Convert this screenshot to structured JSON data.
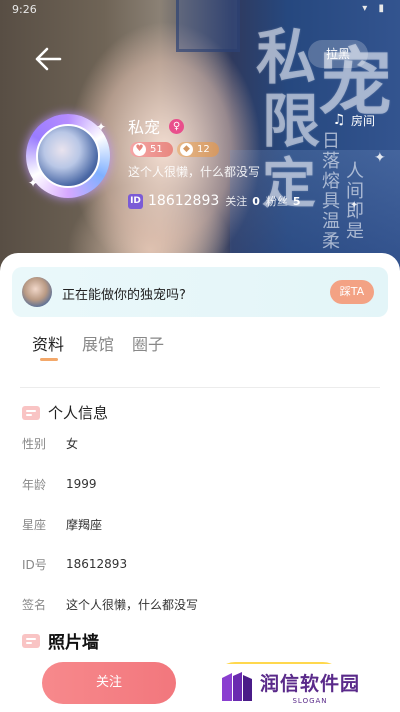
{
  "status_bar": {
    "time": "9:26",
    "icons": "▾ ▮"
  },
  "header": {
    "back_icon": "arrow-left-icon",
    "block_label": "拉黑",
    "room_label": "房间",
    "room_icon": "music-note-icon",
    "background_text": [
      "私",
      "限",
      "定",
      "宠"
    ],
    "background_small_text": [
      "日落熔具温柔",
      "人间即是"
    ]
  },
  "profile": {
    "nickname": "私宠",
    "gender": "female",
    "gender_icon": "♀",
    "wealth_level": "51",
    "charm_level": "12",
    "signature": "这个人很懒，什么都没写",
    "id_badge": "ID",
    "id": "18612893",
    "follow_label": "关注",
    "follow_count": "0",
    "fans_label": "粉丝",
    "fans_count": "5"
  },
  "exclusive_banner": {
    "text": "正在能做你的独宠吗?",
    "button_label": "踩TA"
  },
  "tabs": [
    {
      "label": "资料",
      "active": true
    },
    {
      "label": "展馆",
      "active": false
    },
    {
      "label": "圈子",
      "active": false
    }
  ],
  "personal_info": {
    "title": "个人信息",
    "rows": [
      {
        "label": "性别",
        "value": "女"
      },
      {
        "label": "年龄",
        "value": "1999"
      },
      {
        "label": "星座",
        "value": "摩羯座"
      },
      {
        "label": "ID号",
        "value": "18612893"
      },
      {
        "label": "签名",
        "value": "这个人很懒，什么都没写"
      }
    ]
  },
  "photo_wall": {
    "title": "照片墙"
  },
  "bottom_bar": {
    "follow_label": "关注"
  },
  "watermark": {
    "name": "润信软件园",
    "slogan": "SLOGAN"
  },
  "colors": {
    "accent_tab": "#f3a86a",
    "follow_button": "#f2777d",
    "ta_button": "#f3a284",
    "banner_bg": "#e3f5f8",
    "gender_female": "#e94f8c"
  }
}
